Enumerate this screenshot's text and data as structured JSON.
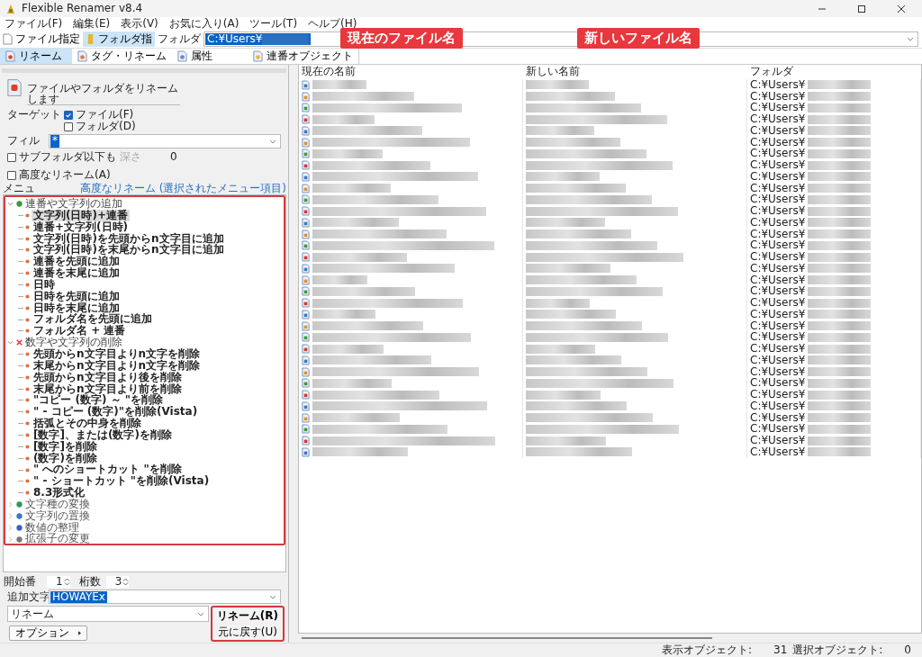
{
  "window": {
    "title": "Flexible Renamer v8.4"
  },
  "menu": [
    "ファイル(F)",
    "編集(E)",
    "表示(V)",
    "お気に入り(A)",
    "ツール(T)",
    "ヘルプ(H)"
  ],
  "toolbar": {
    "buttons": [
      {
        "label": "ファイル指定",
        "selected": false
      },
      {
        "label": "フォルダ指",
        "selected": true
      }
    ],
    "folder_label": "フォルダ",
    "folder_value": "C:¥Users¥"
  },
  "tabs": [
    {
      "label": "リネーム",
      "selected": true
    },
    {
      "label": "タグ・リネーム",
      "selected": false
    },
    {
      "label": "属性",
      "selected": false
    },
    {
      "label": "連番オブジェクト",
      "selected": false
    }
  ],
  "annotations": [
    "現在のファイル名",
    "新しいファイル名"
  ],
  "panel": {
    "description": "ファイルやフォルダをリネームします",
    "target_label": "ターゲット",
    "targets": [
      {
        "label": "ファイル(F)",
        "checked": true
      },
      {
        "label": "フォルダ(D)",
        "checked": false
      }
    ],
    "filter_label": "フィル",
    "filter_value": "*",
    "subfolder": {
      "label": "サブフォルダ以下も",
      "checked": false
    },
    "depth_label": "深さ",
    "depth_value": "0",
    "advanced": {
      "label": "高度なリネーム(A)",
      "checked": false
    },
    "menu_label": "メニュ",
    "advanced_link": "高度なリネーム (選択されたメニュー項目)"
  },
  "tree": [
    {
      "label": "連番や文字列の追加",
      "expanded": true,
      "children": [
        {
          "label": "文字列(日時)+連番",
          "selected": true
        },
        {
          "label": "連番+文字列(日時)",
          "selected": false
        },
        {
          "label": "文字列(日時)を先頭からn文字目に追加",
          "selected": false
        },
        {
          "label": "文字列(日時)を末尾からn文字目に追加",
          "selected": false
        },
        {
          "label": "連番を先頭に追加",
          "selected": false
        },
        {
          "label": "連番を末尾に追加",
          "selected": false
        },
        {
          "label": "日時",
          "selected": false
        },
        {
          "label": "日時を先頭に追加",
          "selected": false
        },
        {
          "label": "日時を末尾に追加",
          "selected": false
        },
        {
          "label": "フォルダ名を先頭に追加",
          "selected": false
        },
        {
          "label": "フォルダ名 + 連番",
          "selected": false
        }
      ]
    },
    {
      "label": "数字や文字列の削除",
      "expanded": true,
      "children": [
        {
          "label": "先頭からn文字目よりn文字を削除",
          "selected": false
        },
        {
          "label": "末尾からn文字目よりn文字を削除",
          "selected": false
        },
        {
          "label": "先頭からn文字目より後を削除",
          "selected": false
        },
        {
          "label": "末尾からn文字目より前を削除",
          "selected": false
        },
        {
          "label": "\"コピー (数字) ～ \"を削除",
          "selected": false
        },
        {
          "label": "\" - コピー (数字)\"を削除(Vista)",
          "selected": false
        },
        {
          "label": "括弧とその中身を削除",
          "selected": false
        },
        {
          "label": "[数字]、または(数字)を削除",
          "selected": false
        },
        {
          "label": "[数字]を削除",
          "selected": false
        },
        {
          "label": "(数字)を削除",
          "selected": false
        },
        {
          "label": "\" へのショートカット \"を削除",
          "selected": false
        },
        {
          "label": "\" - ショートカット \"を削除(Vista)",
          "selected": false
        },
        {
          "label": "8.3形式化",
          "selected": false
        }
      ]
    },
    {
      "label": "文字種の変換",
      "expanded": false
    },
    {
      "label": "文字列の置換",
      "expanded": false
    },
    {
      "label": "数値の整理",
      "expanded": false
    },
    {
      "label": "拡張子の変更",
      "expanded": false
    }
  ],
  "options": {
    "start_label": "開始番",
    "start_value": "1",
    "digits_label": "桁数",
    "digits_value": "3",
    "add_label": "追加文字",
    "add_value": "HOWAYEx",
    "mode_value": "リネーム",
    "option_button": "オプション",
    "rename_button": "リネーム(R)",
    "undo_button": "元に戻す(U)"
  },
  "table": {
    "columns": [
      "現在の名前",
      "新しい名前",
      "フォルダ"
    ],
    "rows": [
      {
        "folder": "C:¥Users¥"
      },
      {
        "folder": "C:¥Users¥"
      },
      {
        "folder": "C:¥Users¥"
      },
      {
        "folder": "C:¥Users¥"
      },
      {
        "folder": "C:¥Users¥"
      },
      {
        "folder": "C:¥Users¥"
      },
      {
        "folder": "C:¥Users¥"
      },
      {
        "folder": "C:¥Users¥"
      },
      {
        "folder": "C:¥Users¥"
      },
      {
        "folder": "C:¥Users¥"
      },
      {
        "folder": "C:¥Users¥"
      },
      {
        "folder": "C:¥Users¥"
      },
      {
        "folder": "C:¥Users¥"
      },
      {
        "folder": "C:¥Users¥"
      },
      {
        "folder": "C:¥Users¥"
      },
      {
        "folder": "C:¥Users¥"
      },
      {
        "folder": "C:¥Users¥"
      },
      {
        "folder": "C:¥Users¥"
      },
      {
        "folder": "C:¥Users¥"
      },
      {
        "folder": "C:¥Users¥"
      },
      {
        "folder": "C:¥Users¥"
      },
      {
        "folder": "C:¥Users¥"
      },
      {
        "folder": "C:¥Users¥"
      },
      {
        "folder": "C:¥Users¥"
      },
      {
        "folder": "C:¥Users¥"
      },
      {
        "folder": "C:¥Users¥"
      },
      {
        "folder": "C:¥Users¥"
      },
      {
        "folder": "C:¥Users¥"
      },
      {
        "folder": "C:¥Users¥"
      },
      {
        "folder": "C:¥Users¥"
      },
      {
        "folder": "C:¥Users¥"
      },
      {
        "folder": "C:¥Users¥"
      },
      {
        "folder": "C:¥Users¥"
      }
    ]
  },
  "status_bar": {
    "shown_label": "表示オブジェクト:",
    "shown_value": "31",
    "selected_label": "選択オブジェクト:",
    "selected_value": "0"
  }
}
